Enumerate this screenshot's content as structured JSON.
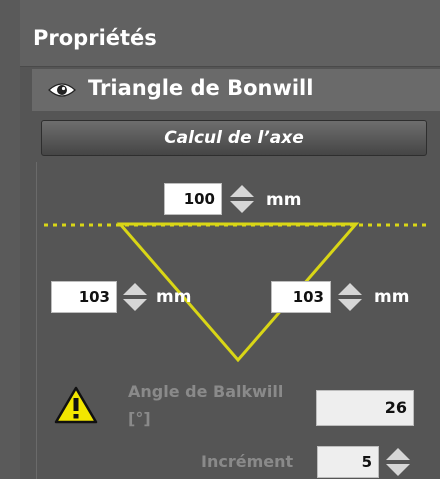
{
  "panel": {
    "title": "Propriétés"
  },
  "section": {
    "title": "Triangle de Bonwill",
    "visibility_icon": "eye-icon"
  },
  "calc_button": {
    "label": "Calcul de l’axe"
  },
  "triangle": {
    "top_value": "100",
    "left_value": "103",
    "right_value": "103",
    "unit": "mm"
  },
  "balkwill": {
    "label_line1": "Angle de Balkwill",
    "label_line2": "[°]",
    "value": "26",
    "warning_icon": "warning-icon"
  },
  "increment": {
    "label": "Incrément",
    "value": "5"
  },
  "colors": {
    "triangle": "#d9d616",
    "panel_bg": "#555555",
    "button_top": "#6e6e6e",
    "button_bottom": "#454545"
  }
}
